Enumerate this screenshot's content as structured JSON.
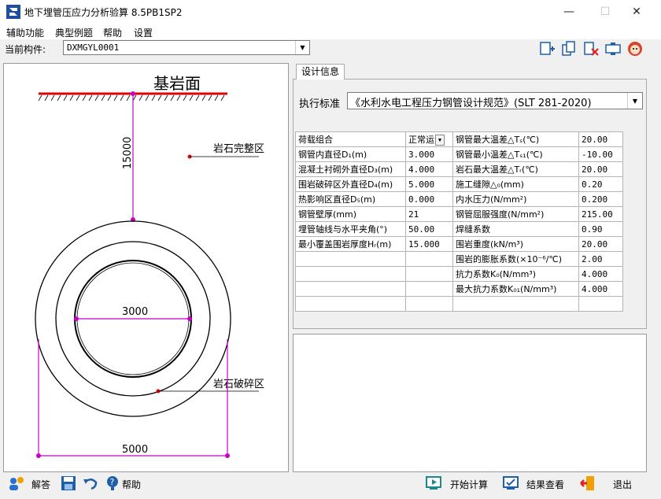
{
  "window": {
    "title": "地下埋管压应力分析验算 8.5PB1SP2",
    "minimize": "—",
    "maximize": "☐",
    "close": "✕"
  },
  "menu": [
    "辅助功能",
    "典型例题",
    "帮助",
    "设置"
  ],
  "component": {
    "label": "当前构件:",
    "value": "DXMGYL0001"
  },
  "toolbar_icons": [
    "new-file-icon",
    "copy-icon",
    "delete-file-icon",
    "export-icon",
    "avatar-icon"
  ],
  "drawing": {
    "bedrock_label": "基岩面",
    "depth_label": "15000",
    "intact_rock_label": "岩石完整区",
    "fractured_rock_label": "岩石破碎区",
    "inner_diameter_label": "3000",
    "outer_diameter_label": "5000"
  },
  "tab": {
    "label": "设计信息"
  },
  "standard": {
    "label": "执行标准",
    "value": "《水利水电工程压力钢管设计规范》(SLT 281-2020)"
  },
  "params": [
    {
      "l1": "荷载组合",
      "v1": "正常运",
      "l2": "钢管最大温差△Tₛ(℃)",
      "v2": "20.00",
      "combo": true
    },
    {
      "l1": "钢管内直径D₁(m)",
      "v1": "3.000",
      "l2": "钢管最小温差△Tₛ₁(℃)",
      "v2": "-10.00"
    },
    {
      "l1": "混凝土衬砌外直径D₃(m)",
      "v1": "4.000",
      "l2": "岩石最大温差△Tᵣ(℃)",
      "v2": "20.00"
    },
    {
      "l1": "围岩破碎区外直径D₄(m)",
      "v1": "5.000",
      "l2": "施工缝隙△₀(mm)",
      "v2": "0.20"
    },
    {
      "l1": "热影响区直径D₅(m)",
      "v1": "0.000",
      "l2": "内水压力(N/mm²)",
      "v2": "0.200"
    },
    {
      "l1": "钢管壁厚(mm)",
      "v1": "21",
      "l2": "钢管屈服强度(N/mm²)",
      "v2": "215.00"
    },
    {
      "l1": "埋管轴线与水平夹角(°)",
      "v1": "50.00",
      "l2": "焊缝系数",
      "v2": "0.90"
    },
    {
      "l1": "最小覆盖围岩厚度Hᵣ(m)",
      "v1": "15.000",
      "l2": "围岩重度(kN/m³)",
      "v2": "20.00"
    },
    {
      "l1": "",
      "v1": "",
      "l2": "围岩的膨胀系数(×10⁻⁶/℃)",
      "v2": "2.00"
    },
    {
      "l1": "",
      "v1": "",
      "l2": "抗力系数K₀(N/mm³)",
      "v2": "4.000"
    },
    {
      "l1": "",
      "v1": "",
      "l2": "最大抗力系数K₀₁(N/mm³)",
      "v2": "4.000"
    },
    {
      "l1": "",
      "v1": "",
      "l2": "",
      "v2": ""
    }
  ],
  "footer": {
    "answer": "解答",
    "help": "帮助",
    "start_calc": "开始计算",
    "view_results": "结果查看",
    "exit": "退出"
  }
}
